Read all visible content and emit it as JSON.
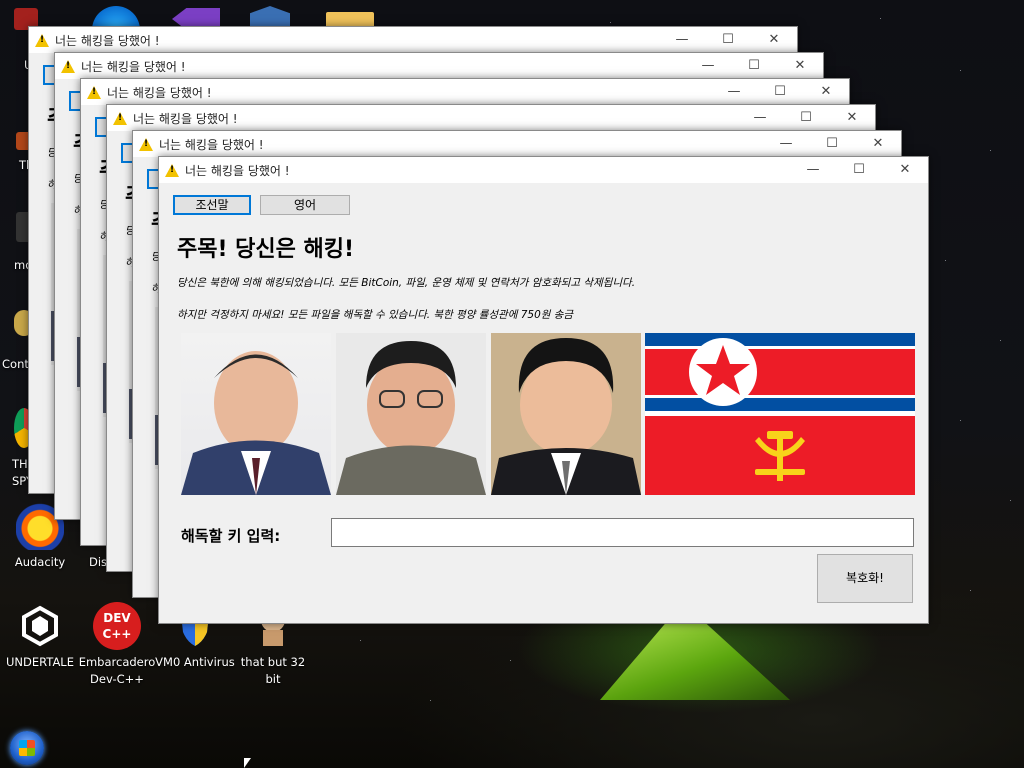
{
  "desktop": {
    "icons": [
      {
        "label": "UNDERTALE"
      },
      {
        "label": "Embarcadero Dev-C++"
      },
      {
        "label": "VM0 Antivirus"
      },
      {
        "label": "that but 32 bit"
      },
      {
        "label": "Audacity"
      }
    ],
    "partial_labels": [
      "U",
      "Th",
      "mo",
      "Conti",
      "TH SPY",
      "Dis"
    ],
    "devcpp_text": "DEV C++"
  },
  "window": {
    "title": "너는 해킹을 당했어 !",
    "controls": {
      "minimize": "—",
      "maximize": "☐",
      "close": "✕"
    },
    "lang_buttons": [
      "조선말",
      "영어"
    ],
    "headline": "주목! 당신은 해킹!",
    "line1": "당신은 북한에 의해 해킹되었습니다. 모든 BitCoin, 파일, 운영 체제 및 연락처가 암호화되고 삭제됩니다.",
    "line2": "하지만 걱정하지 마세요! 모든 파일을 해독할 수 있습니다. 북한 평양 률성관에 750원 송금",
    "key_label": "해독할 키 입력:",
    "key_value": "",
    "decrypt_label": "복호화!"
  },
  "colors": {
    "flag_red": "#ed1c27",
    "flag_blue": "#024fa2",
    "flag_star_red": "#ed1c27",
    "emblem_yellow": "#f8d31a",
    "accent": "#0078d7"
  },
  "icons": [
    "warning-icon",
    "start-orb-icon",
    "unity-icon",
    "devcpp-icon",
    "shield-icon",
    "audacity-icon",
    "cursor-icon"
  ]
}
